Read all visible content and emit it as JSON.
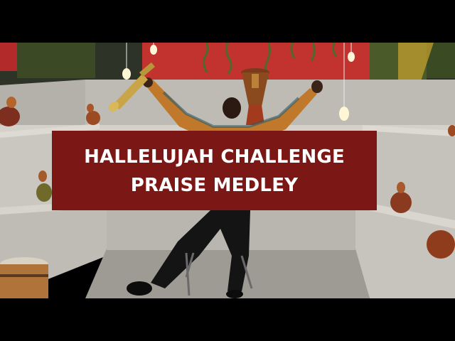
{
  "thumbnail": {
    "title_lines": [
      "HALLELUJAH CHALLENGE",
      "PRAISE MEDLEY"
    ],
    "banner_color": "#7b1714",
    "text_color": "#ffffff",
    "letterbox_color": "#000000"
  },
  "scene": {
    "wall_color": "#c2332f",
    "platform_color": "#c9c7c0",
    "floor_color": "#9e9b94",
    "objects": [
      "trumpet",
      "djembe-drum",
      "gourd-shakers",
      "hanging-bulbs",
      "ivy-vines",
      "bass-drum",
      "stool"
    ]
  }
}
